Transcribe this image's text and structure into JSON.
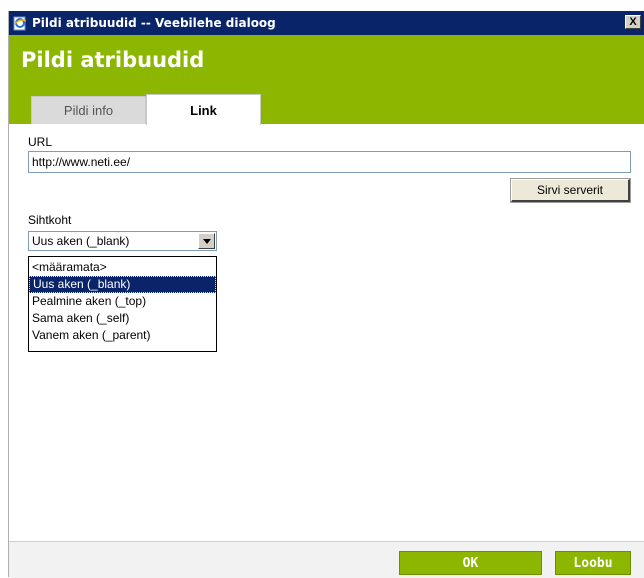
{
  "window": {
    "title": "Pildi atribuudid -- Veebilehe dialoog",
    "close_label": "X"
  },
  "header": {
    "title": "Pildi atribuudid"
  },
  "tabs": [
    {
      "label": "Pildi info",
      "active": false
    },
    {
      "label": "Link",
      "active": true
    }
  ],
  "link_tab": {
    "url_label": "URL",
    "url_value": "http://www.neti.ee/",
    "browse_button": "Sirvi serverit",
    "target_label": "Sihtkoht",
    "target_selected": "Uus aken (_blank)",
    "target_options": [
      "<määramata>",
      "Uus aken (_blank)",
      "Pealmine aken (_top)",
      "Sama aken (_self)",
      "Vanem aken (_parent)"
    ],
    "highlighted_option_index": 1
  },
  "footer": {
    "ok_label": "OK",
    "cancel_label": "Loobu"
  },
  "colors": {
    "accent": "#8db600",
    "titlebar": "#0a246a",
    "selection": "#0a246a"
  },
  "icons": {
    "window_icon": "ie-page-icon",
    "dropdown_arrow": "chevron-down-icon"
  }
}
